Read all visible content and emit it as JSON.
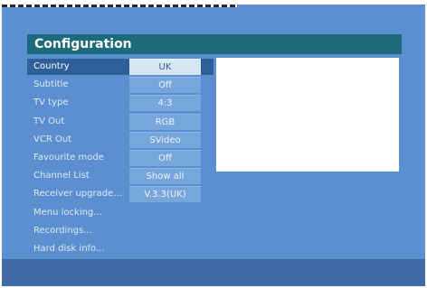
{
  "title": "Configuration",
  "menu": {
    "items": [
      {
        "label": "Country",
        "value": "UK"
      },
      {
        "label": "Subtitle",
        "value": "Off"
      },
      {
        "label": "TV type",
        "value": "4:3"
      },
      {
        "label": "TV Out",
        "value": "RGB"
      },
      {
        "label": "VCR Out",
        "value": "SVideo"
      },
      {
        "label": "Favourite mode",
        "value": "Off"
      },
      {
        "label": "Channel List",
        "value": "Show all"
      },
      {
        "label": "Receiver upgrade...",
        "value": "V.3.3(UK)"
      },
      {
        "label": "Menu locking..."
      },
      {
        "label": "Recordings..."
      },
      {
        "label": "Hard disk info..."
      }
    ],
    "selected_index": 0
  },
  "colors": {
    "background": "#5b8fcf",
    "title_bar": "#1c6a7c",
    "selected_row": "#2f5f98",
    "value_box": "#77a6dc",
    "selected_value_box": "#d8e6f4",
    "bottom_bar": "#3f6aa6"
  }
}
